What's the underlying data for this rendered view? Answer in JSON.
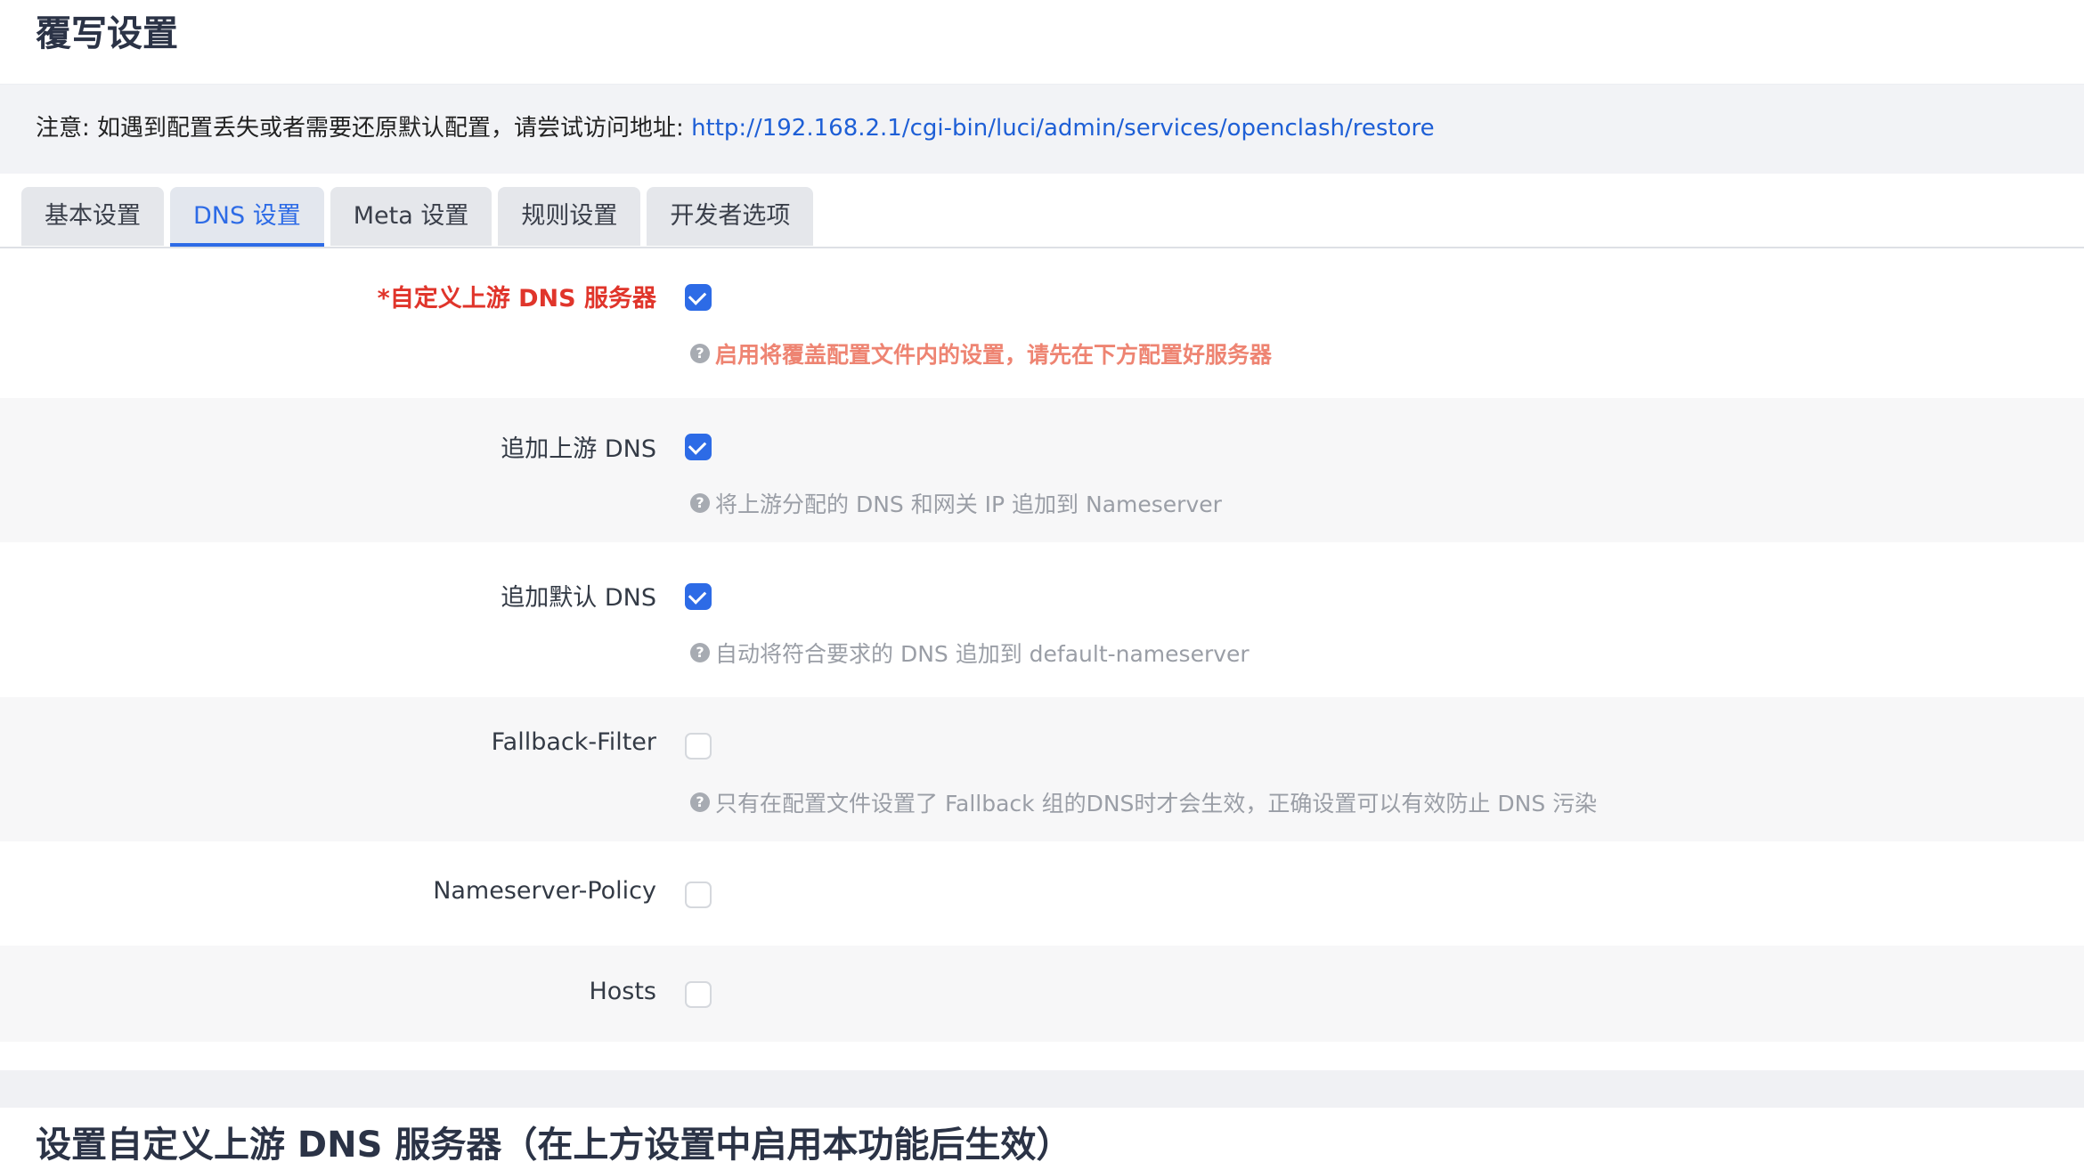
{
  "page": {
    "title": "覆写设置",
    "notice": {
      "text": "注意: 如遇到配置丢失或者需要还原默认配置，请尝试访问地址: ",
      "link": "http://192.168.2.1/cgi-bin/luci/admin/services/openclash/restore"
    },
    "tabs": [
      {
        "label": "基本设置",
        "active": false
      },
      {
        "label": "DNS 设置",
        "active": true
      },
      {
        "label": "Meta 设置",
        "active": false
      },
      {
        "label": "规则设置",
        "active": false
      },
      {
        "label": "开发者选项",
        "active": false
      }
    ],
    "settings": [
      {
        "label": "*自定义上游 DNS 服务器",
        "checked": true,
        "help": "启用将覆盖配置文件内的设置，请先在下方配置好服务器"
      },
      {
        "label": "追加上游 DNS",
        "checked": true,
        "help": "将上游分配的 DNS 和网关 IP 追加到 Nameserver"
      },
      {
        "label": "追加默认 DNS",
        "checked": true,
        "help": "自动将符合要求的 DNS 追加到 default-nameserver"
      },
      {
        "label": "Fallback-Filter",
        "checked": false,
        "help": "只有在配置文件设置了 Fallback 组的DNS时才会生效，正确设置可以有效防止 DNS 污染"
      },
      {
        "label": "Nameserver-Policy",
        "checked": false
      },
      {
        "label": "Hosts",
        "checked": false
      }
    ],
    "section_title": "设置自定义上游 DNS 服务器（在上方设置中启用本功能后生效）"
  },
  "colors": {
    "accent": "#2d6be6",
    "required": "#e0352b",
    "warning_help": "#ee8472",
    "link": "#1e5fd6"
  },
  "icons": {
    "help": "question-circle-icon",
    "checkbox_checked": "checkmark-icon"
  }
}
